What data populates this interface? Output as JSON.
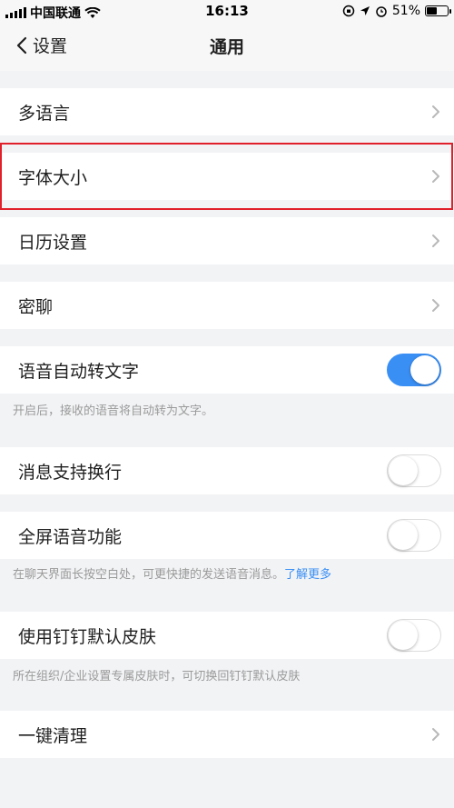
{
  "status_bar": {
    "carrier": "中国联通",
    "time": "16:13",
    "battery_percent": "51%",
    "battery_level": 0.51
  },
  "nav": {
    "back_label": "设置",
    "title": "通用"
  },
  "settings": {
    "language": "多语言",
    "font_size": "字体大小",
    "calendar": "日历设置",
    "secret_chat": "密聊",
    "voice_to_text": {
      "label": "语音自动转文字",
      "on": true,
      "note": "开启后，接收的语音将自动转为文字。"
    },
    "line_break": {
      "label": "消息支持换行",
      "on": false
    },
    "fullscreen_voice": {
      "label": "全屏语音功能",
      "on": false,
      "note": "在聊天界面长按空白处，可更快捷的发送语音消息。",
      "link": "了解更多"
    },
    "default_skin": {
      "label": "使用钉钉默认皮肤",
      "on": false,
      "note": "所在组织/企业设置专属皮肤时，可切换回钉钉默认皮肤"
    },
    "clean_up": "一键清理"
  },
  "colors": {
    "accent": "#3a8ff5",
    "highlight": "#e0202a"
  }
}
